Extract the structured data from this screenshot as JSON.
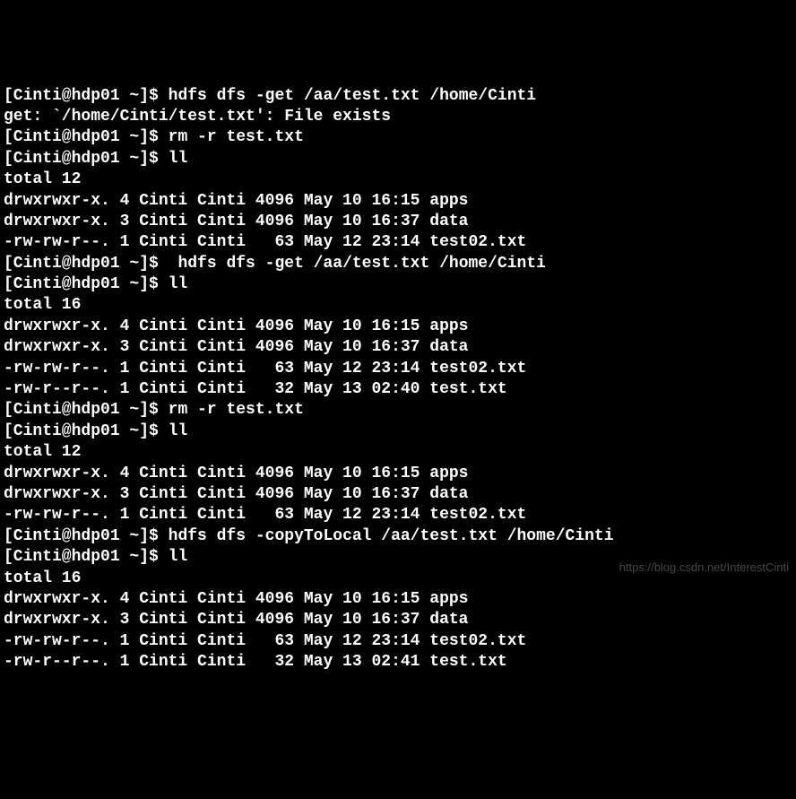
{
  "lines": [
    {
      "type": "prompt",
      "prompt": "[Cinti@hdp01 ~]$ ",
      "command": "hdfs dfs -get /aa/test.txt /home/Cinti"
    },
    {
      "type": "output",
      "text": "get: `/home/Cinti/test.txt': File exists"
    },
    {
      "type": "prompt",
      "prompt": "[Cinti@hdp01 ~]$ ",
      "command": "rm -r test.txt"
    },
    {
      "type": "prompt",
      "prompt": "[Cinti@hdp01 ~]$ ",
      "command": "ll"
    },
    {
      "type": "output",
      "text": "total 12"
    },
    {
      "type": "ls",
      "perms": "drwxrwxr-x.",
      "links": "4",
      "owner": "Cinti",
      "group": "Cinti",
      "size": "4096",
      "date": "May 10 16:15",
      "name": "apps",
      "bold": true
    },
    {
      "type": "ls",
      "perms": "drwxrwxr-x.",
      "links": "3",
      "owner": "Cinti",
      "group": "Cinti",
      "size": "4096",
      "date": "May 10 16:37",
      "name": "data",
      "bold": true
    },
    {
      "type": "ls",
      "perms": "-rw-rw-r--.",
      "links": "1",
      "owner": "Cinti",
      "group": "Cinti",
      "size": "  63",
      "date": "May 12 23:14",
      "name": "test02.txt",
      "bold": false
    },
    {
      "type": "prompt",
      "prompt": "[Cinti@hdp01 ~]$ ",
      "command": " hdfs dfs -get /aa/test.txt /home/Cinti"
    },
    {
      "type": "prompt",
      "prompt": "[Cinti@hdp01 ~]$ ",
      "command": "ll"
    },
    {
      "type": "output",
      "text": "total 16"
    },
    {
      "type": "ls",
      "perms": "drwxrwxr-x.",
      "links": "4",
      "owner": "Cinti",
      "group": "Cinti",
      "size": "4096",
      "date": "May 10 16:15",
      "name": "apps",
      "bold": true
    },
    {
      "type": "ls",
      "perms": "drwxrwxr-x.",
      "links": "3",
      "owner": "Cinti",
      "group": "Cinti",
      "size": "4096",
      "date": "May 10 16:37",
      "name": "data",
      "bold": true
    },
    {
      "type": "ls",
      "perms": "-rw-rw-r--.",
      "links": "1",
      "owner": "Cinti",
      "group": "Cinti",
      "size": "  63",
      "date": "May 12 23:14",
      "name": "test02.txt",
      "bold": false
    },
    {
      "type": "ls",
      "perms": "-rw-r--r--.",
      "links": "1",
      "owner": "Cinti",
      "group": "Cinti",
      "size": "  32",
      "date": "May 13 02:40",
      "name": "test.txt",
      "bold": false
    },
    {
      "type": "prompt",
      "prompt": "[Cinti@hdp01 ~]$ ",
      "command": "rm -r test.txt"
    },
    {
      "type": "prompt",
      "prompt": "[Cinti@hdp01 ~]$ ",
      "command": "ll"
    },
    {
      "type": "output",
      "text": "total 12"
    },
    {
      "type": "ls",
      "perms": "drwxrwxr-x.",
      "links": "4",
      "owner": "Cinti",
      "group": "Cinti",
      "size": "4096",
      "date": "May 10 16:15",
      "name": "apps",
      "bold": true
    },
    {
      "type": "ls",
      "perms": "drwxrwxr-x.",
      "links": "3",
      "owner": "Cinti",
      "group": "Cinti",
      "size": "4096",
      "date": "May 10 16:37",
      "name": "data",
      "bold": true
    },
    {
      "type": "ls",
      "perms": "-rw-rw-r--.",
      "links": "1",
      "owner": "Cinti",
      "group": "Cinti",
      "size": "  63",
      "date": "May 12 23:14",
      "name": "test02.txt",
      "bold": false
    },
    {
      "type": "prompt",
      "prompt": "[Cinti@hdp01 ~]$ ",
      "command": "hdfs dfs -copyToLocal /aa/test.txt /home/Cinti"
    },
    {
      "type": "prompt",
      "prompt": "[Cinti@hdp01 ~]$ ",
      "command": "ll"
    },
    {
      "type": "output",
      "text": "total 16"
    },
    {
      "type": "ls",
      "perms": "drwxrwxr-x.",
      "links": "4",
      "owner": "Cinti",
      "group": "Cinti",
      "size": "4096",
      "date": "May 10 16:15",
      "name": "apps",
      "bold": true
    },
    {
      "type": "ls",
      "perms": "drwxrwxr-x.",
      "links": "3",
      "owner": "Cinti",
      "group": "Cinti",
      "size": "4096",
      "date": "May 10 16:37",
      "name": "data",
      "bold": true
    },
    {
      "type": "ls",
      "perms": "-rw-rw-r--.",
      "links": "1",
      "owner": "Cinti",
      "group": "Cinti",
      "size": "  63",
      "date": "May 12 23:14",
      "name": "test02.txt",
      "bold": false
    },
    {
      "type": "ls",
      "perms": "-rw-r--r--.",
      "links": "1",
      "owner": "Cinti",
      "group": "Cinti",
      "size": "  32",
      "date": "May 13 02:41",
      "name": "test.txt",
      "bold": false
    }
  ],
  "watermark": "https://blog.csdn.net/InterestCinti"
}
